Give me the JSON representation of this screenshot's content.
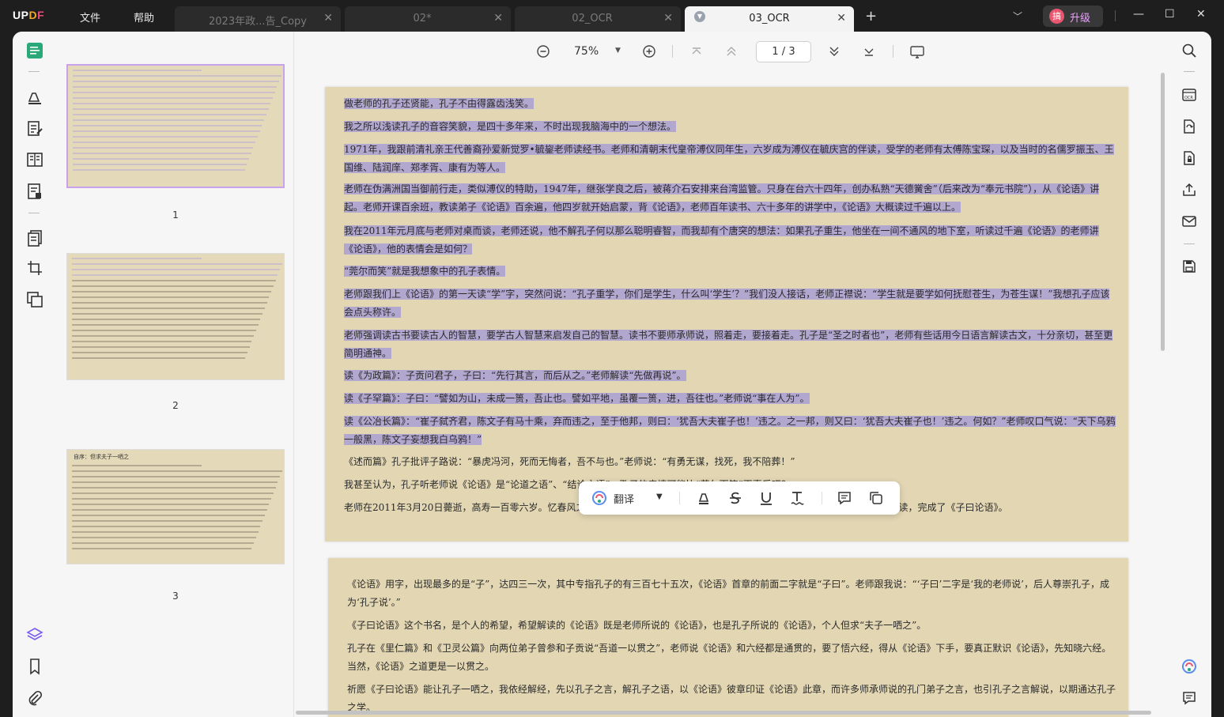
{
  "app": {
    "logo_text_a": "UP",
    "logo_text_b": "D",
    "logo_text_c": "F",
    "menus": [
      "文件",
      "帮助"
    ]
  },
  "tabs": [
    {
      "label": "2023年政...告_Copy",
      "active": false
    },
    {
      "label": "02*",
      "active": false
    },
    {
      "label": "02_OCR",
      "active": false
    },
    {
      "label": "03_OCR",
      "active": true
    }
  ],
  "titlebar": {
    "new_tab": "+",
    "avatar_glyph": "搞",
    "upgrade_label": "升级"
  },
  "viewer": {
    "zoom": "75%",
    "page_indicator": "1 / 3"
  },
  "thumbnails": [
    {
      "number": "1"
    },
    {
      "number": "2"
    },
    {
      "number": "3",
      "heading": "自序：但求夫子一哂之"
    }
  ],
  "floating_toolbar": {
    "translate_label": "翻译"
  },
  "page1": {
    "paragraphs": [
      {
        "text": "做老师的孔子还贤能，孔子不由得露齿浅笑。",
        "selected": true
      },
      {
        "text": "我之所以浅读孔子的音容笑貌，是四十多年来，不时出现我脑海中的一个想法。",
        "selected": true
      },
      {
        "text": "1971年，我跟前清礼亲王代善裔孙爱新觉罗•毓鋆老师读经书。老师和清朝末代皇帝溥仪同年生，六岁成为溥仪在毓庆宫的伴读，受学的老师有太傅陈宝琛，以及当时的名儒罗振玉、王国维、陆润庠、郑孝胥、康有为等人。",
        "selected": true
      },
      {
        "text": "老师在伪满洲国当御前行走，类似溥仪的特助，1947年，继张学良之后，被蒋介石安排来台湾监管。只身在台六十四年，创办私熟“天德黉舍”（后来改为“奉元书院”），从《论语》讲起。老师开课百余班，教读弟子《论语》百余遍，他四岁就开始启蒙，背《论语》，老师百年读书、六十多年的讲学中，《论语》大概读过千遍以上。",
        "selected": true
      },
      {
        "text": "我在2011年元月底与老师对桌而谈，老师还说，他不解孔子何以那么聪明睿智，而我却有个唐突的想法：如果孔子重生，他坐在一间不通风的地下室，听读过千遍《论语》的老师讲《论语》，他的表情会是如何？",
        "selected": true
      },
      {
        "text": "“莞尔而笑”就是我想象中的孔子表情。",
        "selected": true
      },
      {
        "text": "老师跟我们上《论语》的第一天读“学”字，突然问说：“孔子重学，你们是学生，什么叫‘学生’？”我们没人接话，老师正襟说：“学生就是要学如何抚慰苍生，为苍生谋！”我想孔子应该会点头称许。",
        "selected": true
      },
      {
        "text": "老师强调读古书要读古人的智慧，要学古人智慧来启发自己的智慧。读书不要师承师说，照着走，要接着走。孔子是“圣之时者也”，老师有些话用今日语言解读古文，十分亲切，甚至更简明通神。",
        "selected": true
      },
      {
        "text": "读《为政篇》：子贡问君子，子曰：“先行其言，而后从之。”老师解读“先做再说”。",
        "selected": true
      },
      {
        "text": "读《子罕篇》：子曰：“譬如为山，未成一篑，吾止也。譬如平地，虽覆一篑，进，吾往也。”老师说“事在人为”。",
        "selected": true
      },
      {
        "text": "读《公冶长篇》：“崔子弑齐君，陈文子有马十乘，弃而违之，至于他邦，则曰：‘犹吾大夫崔子也！’违之。之一邦，则又曰：‘犹吾大夫崔子也！’违之。何如？”老师叹口气说：“天下乌鸦一般黑，陈文子妄想我白乌鸦！”",
        "selected": true
      },
      {
        "text": "《述而篇》孔子批评子路说：“暴虎冯河，死而无悔者，吾不与也。”老师说：“有勇无谋，找死，我不陪葬！”",
        "selected": false
      },
      {
        "text": "我甚至认为，孔子听老师说《论语》是“论道之语”、“结论之语”，孔子的表情可能比“莞尔而笑”更喜乐吧？",
        "selected": false
      },
      {
        "text": "老师在2011年3月20日薨逝，高寿一百零六岁。忆春风之沐，怀化雨师恩。老师常说，一个人至少要读懂一本书，我遵师命，用笔代读，完成了《子曰论语》。",
        "selected": false
      }
    ]
  },
  "page2": {
    "paragraphs": [
      {
        "text": "《论语》用字，出现最多的是“子”，达四三一次，其中专指孔子的有三百七十五次，《论语》首章的前面二字就是“子曰”。老师跟我说：“‘子曰’二字是‘我的老师说’，后人尊崇孔子，成为‘孔子说’。”"
      },
      {
        "text": "《子曰论语》这个书名，是个人的希望，希望解读的《论语》既是老师所说的《论语》，也是孔子所说的《论语》，个人但求“夫子一哂之”。"
      },
      {
        "text": "孔子在《里仁篇》和《卫灵公篇》向两位弟子曾参和子贡说“吾道一以贯之”，老师说《论语》和六经都是通贯的，要了悟六经，得从《论语》下手，要真正默识《论语》，先知晓六经。当然，《论语》之道更是一以贯之。"
      },
      {
        "text": "祈愿《子曰论语》能让孔子一哂之，我依经解经，先以孔子之言，解孔子之语，以《论语》彼章印证《论语》此章，而许多师承师说的孔门弟子之言，也引孔子之言解说，以期通达孔子之学。"
      }
    ]
  }
}
